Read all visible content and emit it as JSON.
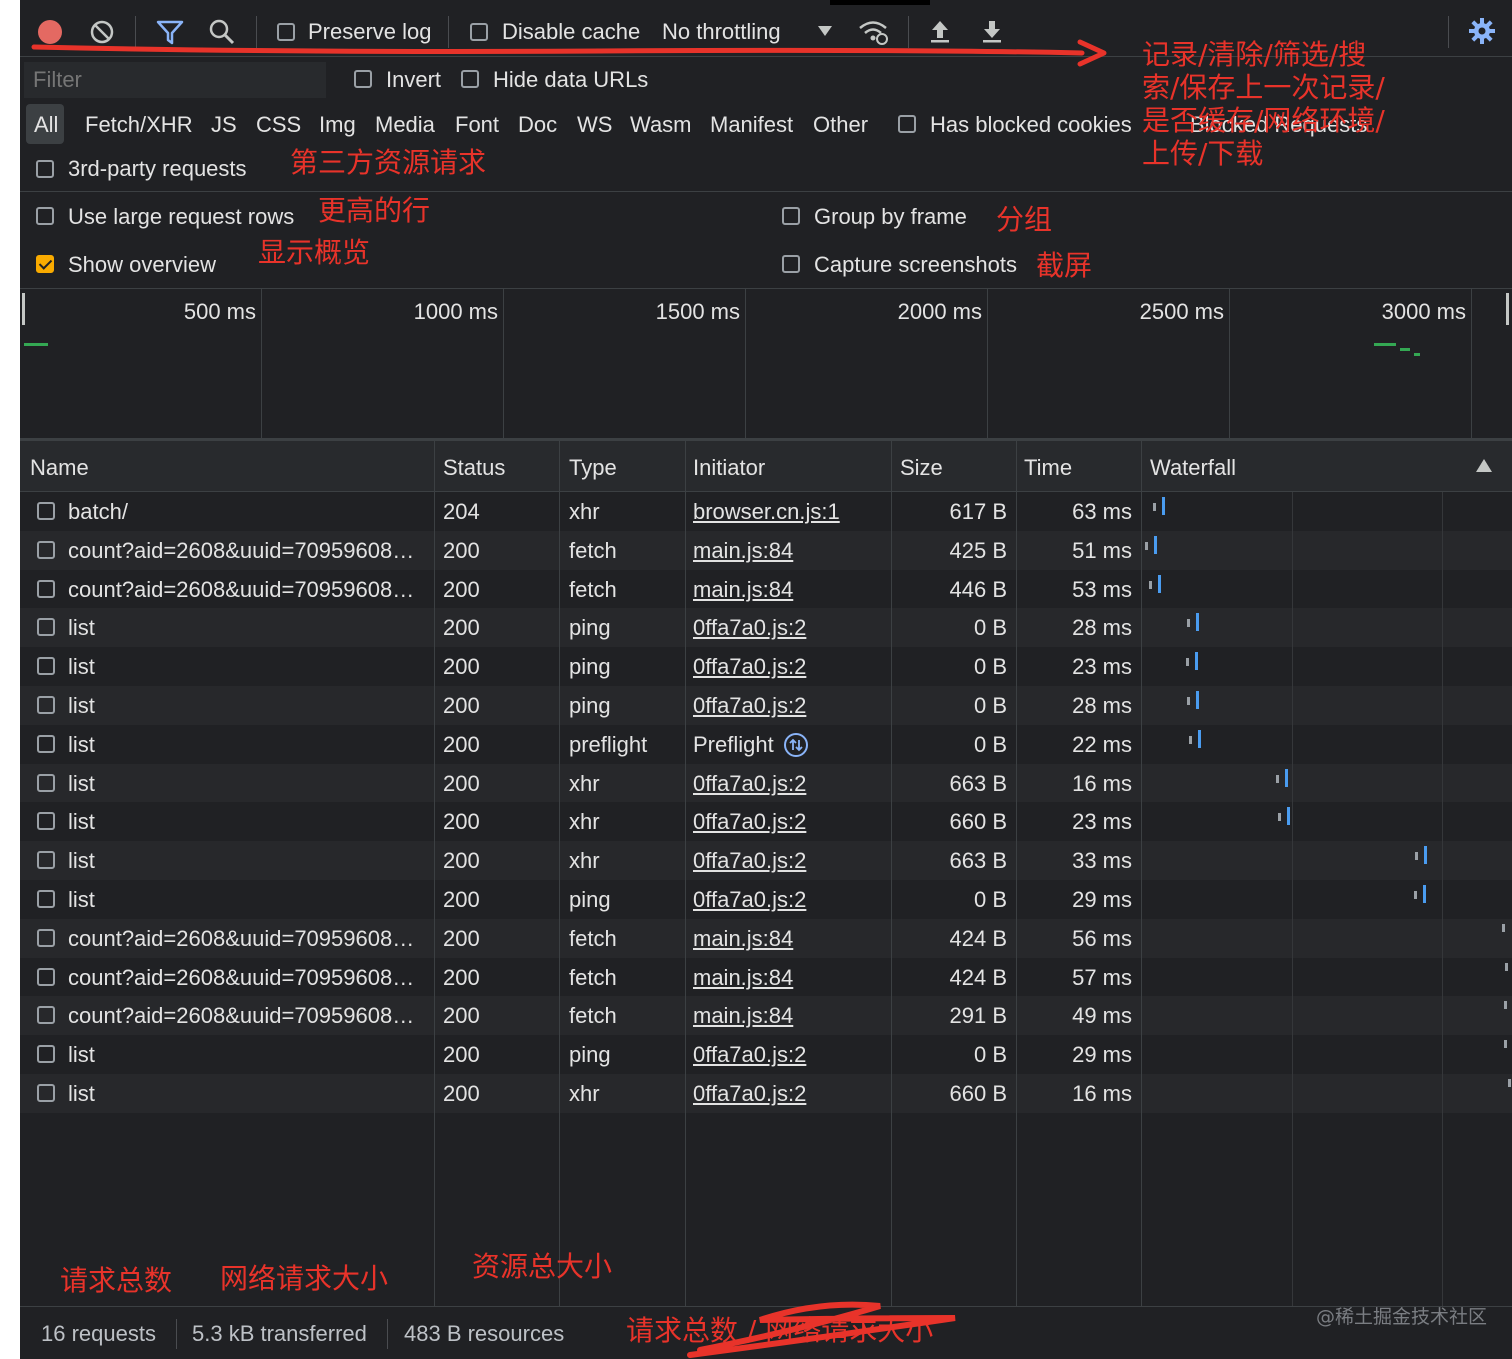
{
  "toolbar": {
    "preserve_log": "Preserve log",
    "disable_cache": "Disable cache",
    "throttling": "No throttling"
  },
  "filter_bar": {
    "placeholder": "Filter",
    "invert": "Invert",
    "hide_data_urls": "Hide data URLs"
  },
  "type_filters": [
    "All",
    "Fetch/XHR",
    "JS",
    "CSS",
    "Img",
    "Media",
    "Font",
    "Doc",
    "WS",
    "Wasm",
    "Manifest",
    "Other"
  ],
  "has_blocked_cookies": "Has blocked cookies",
  "blocked_requests": "Blocked Requests",
  "third_party": "3rd-party requests",
  "settings": {
    "large_rows": "Use large request rows",
    "show_overview": "Show overview",
    "group_by_frame": "Group by frame",
    "capture_screenshots": "Capture screenshots",
    "show_overview_checked": true
  },
  "overview_ticks": [
    "500 ms",
    "1000 ms",
    "1500 ms",
    "2000 ms",
    "2500 ms",
    "3000 ms"
  ],
  "columns": {
    "name": "Name",
    "status": "Status",
    "type": "Type",
    "initiator": "Initiator",
    "size": "Size",
    "time": "Time",
    "waterfall": "Waterfall"
  },
  "rows": [
    {
      "name": "batch/",
      "status": "204",
      "type": "xhr",
      "initiator": "browser.cn.js:1",
      "size": "617 B",
      "time": "63 ms"
    },
    {
      "name": "count?aid=2608&uuid=70959608…",
      "status": "200",
      "type": "fetch",
      "initiator": "main.js:84",
      "size": "425 B",
      "time": "51 ms"
    },
    {
      "name": "count?aid=2608&uuid=70959608…",
      "status": "200",
      "type": "fetch",
      "initiator": "main.js:84",
      "size": "446 B",
      "time": "53 ms"
    },
    {
      "name": "list",
      "status": "200",
      "type": "ping",
      "initiator": "0ffa7a0.js:2",
      "size": "0 B",
      "time": "28 ms"
    },
    {
      "name": "list",
      "status": "200",
      "type": "ping",
      "initiator": "0ffa7a0.js:2",
      "size": "0 B",
      "time": "23 ms"
    },
    {
      "name": "list",
      "status": "200",
      "type": "ping",
      "initiator": "0ffa7a0.js:2",
      "size": "0 B",
      "time": "28 ms"
    },
    {
      "name": "list",
      "status": "200",
      "type": "preflight",
      "initiator": "Preflight",
      "size": "0 B",
      "time": "22 ms"
    },
    {
      "name": "list",
      "status": "200",
      "type": "xhr",
      "initiator": "0ffa7a0.js:2",
      "size": "663 B",
      "time": "16 ms"
    },
    {
      "name": "list",
      "status": "200",
      "type": "xhr",
      "initiator": "0ffa7a0.js:2",
      "size": "660 B",
      "time": "23 ms"
    },
    {
      "name": "list",
      "status": "200",
      "type": "xhr",
      "initiator": "0ffa7a0.js:2",
      "size": "663 B",
      "time": "33 ms"
    },
    {
      "name": "list",
      "status": "200",
      "type": "ping",
      "initiator": "0ffa7a0.js:2",
      "size": "0 B",
      "time": "29 ms"
    },
    {
      "name": "count?aid=2608&uuid=70959608…",
      "status": "200",
      "type": "fetch",
      "initiator": "main.js:84",
      "size": "424 B",
      "time": "56 ms"
    },
    {
      "name": "count?aid=2608&uuid=70959608…",
      "status": "200",
      "type": "fetch",
      "initiator": "main.js:84",
      "size": "424 B",
      "time": "57 ms"
    },
    {
      "name": "count?aid=2608&uuid=70959608…",
      "status": "200",
      "type": "fetch",
      "initiator": "main.js:84",
      "size": "291 B",
      "time": "49 ms"
    },
    {
      "name": "list",
      "status": "200",
      "type": "ping",
      "initiator": "0ffa7a0.js:2",
      "size": "0 B",
      "time": "29 ms"
    },
    {
      "name": "list",
      "status": "200",
      "type": "xhr",
      "initiator": "0ffa7a0.js:2",
      "size": "660 B",
      "time": "16 ms"
    }
  ],
  "summary": {
    "requests": "16 requests",
    "transferred": "5.3 kB transferred",
    "resources": "483 B resources"
  },
  "annotations": {
    "toolbar_note_1": "记录/清除/筛选/搜",
    "toolbar_note_2": "索/保存上一次记录/",
    "toolbar_note_3": "是否缓存/网络环境/",
    "toolbar_note_4": "上传/下载",
    "third_party": "第三方资源请求",
    "large_rows": "更高的行",
    "show_overview": "显示概览",
    "group": "分组",
    "screenshot": "截屏",
    "total_requests": "请求总数",
    "network_size": "网络请求大小",
    "resource_size": "资源总大小",
    "struck_text": "请求总数 / 网络请求大小"
  },
  "watermark": "@稀土掘金技术社区",
  "colors": {
    "bg": "#202124",
    "accent_blue": "#4a9cf0",
    "record_red": "#e46962",
    "annotation_red": "#e8332a",
    "checkbox_orange": "#f9ab00"
  }
}
